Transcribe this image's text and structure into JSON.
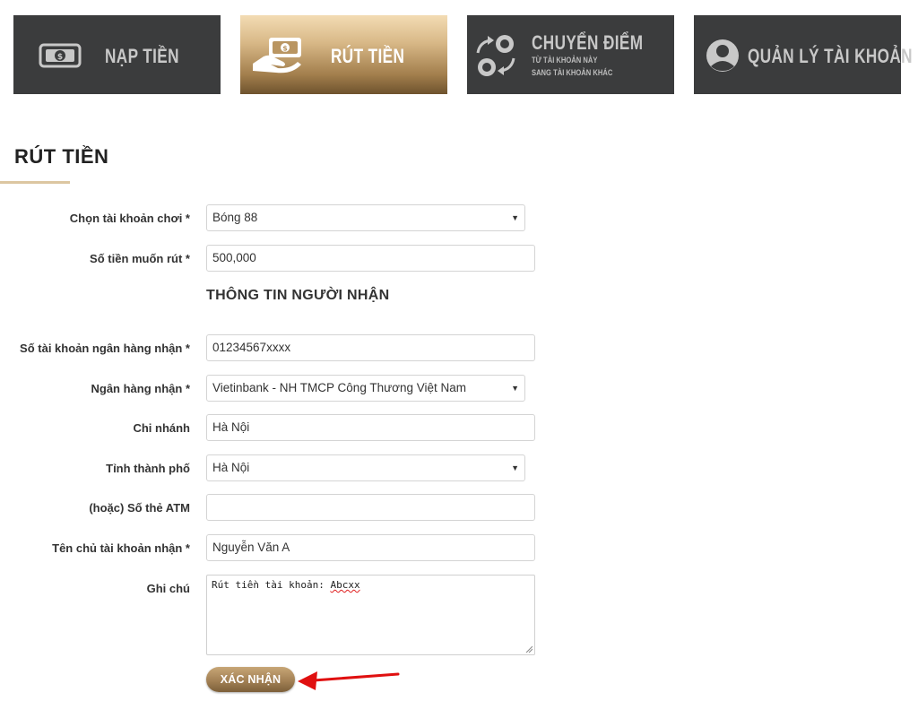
{
  "nav": {
    "tabs": [
      {
        "label": "NẠP TIỀN",
        "icon": "cash-icon",
        "active": false
      },
      {
        "label": "RÚT TIỀN",
        "icon": "hand-cash-icon",
        "active": true
      },
      {
        "label": "CHUYỂN ĐIỂM",
        "sub1": "TỪ TÀI KHOẢN NÀY",
        "sub2": "SANG TÀI KHOẢN KHÁC",
        "icon": "chip-transfer-icon",
        "active": false
      },
      {
        "label": "QUẢN LÝ TÀI KHOẢN",
        "icon": "user-circle-icon",
        "active": false
      }
    ]
  },
  "page": {
    "title": "RÚT TIỀN"
  },
  "form": {
    "account": {
      "label": "Chọn tài khoản chơi *",
      "value": "Bóng 88"
    },
    "amount": {
      "label": "Số tiền muốn rút *",
      "value": "500,000"
    },
    "recipient_heading": "THÔNG TIN NGƯỜI NHẬN",
    "bank_account": {
      "label": "Số tài khoản ngân hàng nhận *",
      "value": "01234567xxxx"
    },
    "bank": {
      "label": "Ngân hàng nhận *",
      "value": "Vietinbank - NH TMCP Công Thương Việt Nam"
    },
    "branch": {
      "label": "Chi nhánh",
      "value": "Hà Nội"
    },
    "province": {
      "label": "Tỉnh thành phố",
      "value": "Hà Nội"
    },
    "atm": {
      "label": "(hoặc) Số thẻ ATM",
      "value": ""
    },
    "holder": {
      "label": "Tên chủ tài khoản nhận *",
      "value": "Nguyễn Văn A"
    },
    "note": {
      "label": "Ghi chú",
      "value_prefix": "Rút tiền tài khoản: ",
      "value_word": "Abcxx"
    },
    "submit_label": "XÁC NHẬN"
  },
  "colors": {
    "tab_bg": "#3b3c3d",
    "accent_gold": "#a38155",
    "arrow_red": "#e01010"
  }
}
